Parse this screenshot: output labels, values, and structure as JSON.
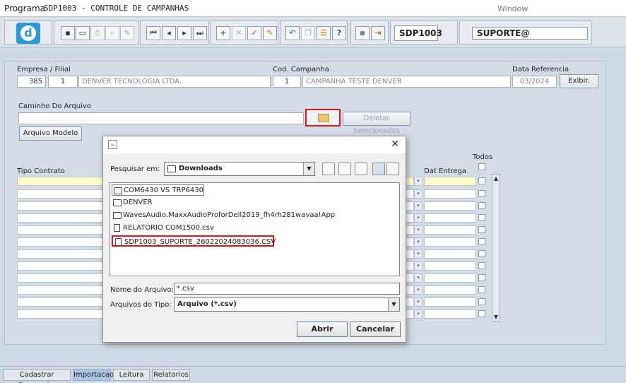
{
  "titlebar": {
    "program_label": "Programa",
    "title": "SDP1003 - CONTROLE DE CAMPANHAS",
    "window_label": "Window"
  },
  "toolbar": {
    "logo_letter": "d",
    "program_code": "SDP1003",
    "user": "SUPORTE@",
    "accent_color": "#2a9ad6"
  },
  "form": {
    "empresa_label": "Empresa / Filial",
    "empresa_code": "385",
    "filial_code": "1",
    "empresa_name": "DENVER TECNOLOGIA LTDA.",
    "cod_campanha_label": "Cod. Campanha",
    "campanha_code": "1",
    "campanha_name": "CAMPANHA TESTE DENVER",
    "data_ref_label": "Data Referencia",
    "data_ref_value": "03/2024",
    "exibir_button": "Exibir.",
    "caminho_label": "Caminho Do Arquivo",
    "caminho_value": "",
    "deletar_button": "Deletar Selecionados",
    "arquivo_modelo_button": "Arquivo Modelo",
    "tipo_contrato_label": "Tipo Contrato",
    "dat_entrega_label": "Dat Entrega",
    "todos_label": "Todos"
  },
  "dialog": {
    "pesquisar_label": "Pesquisar em:",
    "current_folder": "Downloads",
    "files": [
      {
        "name": "COM6430 VS TRP6430",
        "type": "folder"
      },
      {
        "name": "DENVER",
        "type": "folder"
      },
      {
        "name": "WavesAudio.MaxxAudioProforDell2019_fh4rh281wavaa!App",
        "type": "folder"
      },
      {
        "name": "RELATÓRIO COM1500.csv",
        "type": "file"
      },
      {
        "name": "SDP1003_SUPORTE_26022024083036.CSV",
        "type": "file"
      }
    ],
    "nome_label": "Nome do Arquivo:",
    "nome_value": "*.csv",
    "tipo_label": "Arquivos do Tipo:",
    "tipo_value": "Arquivo (*.csv)",
    "abrir_button": "Abrir",
    "cancelar_button": "Cancelar"
  },
  "tabs": [
    "Cadastrar Campanha",
    "Importacao",
    "Leitura",
    "Relatorios"
  ],
  "active_tab": "Importacao"
}
